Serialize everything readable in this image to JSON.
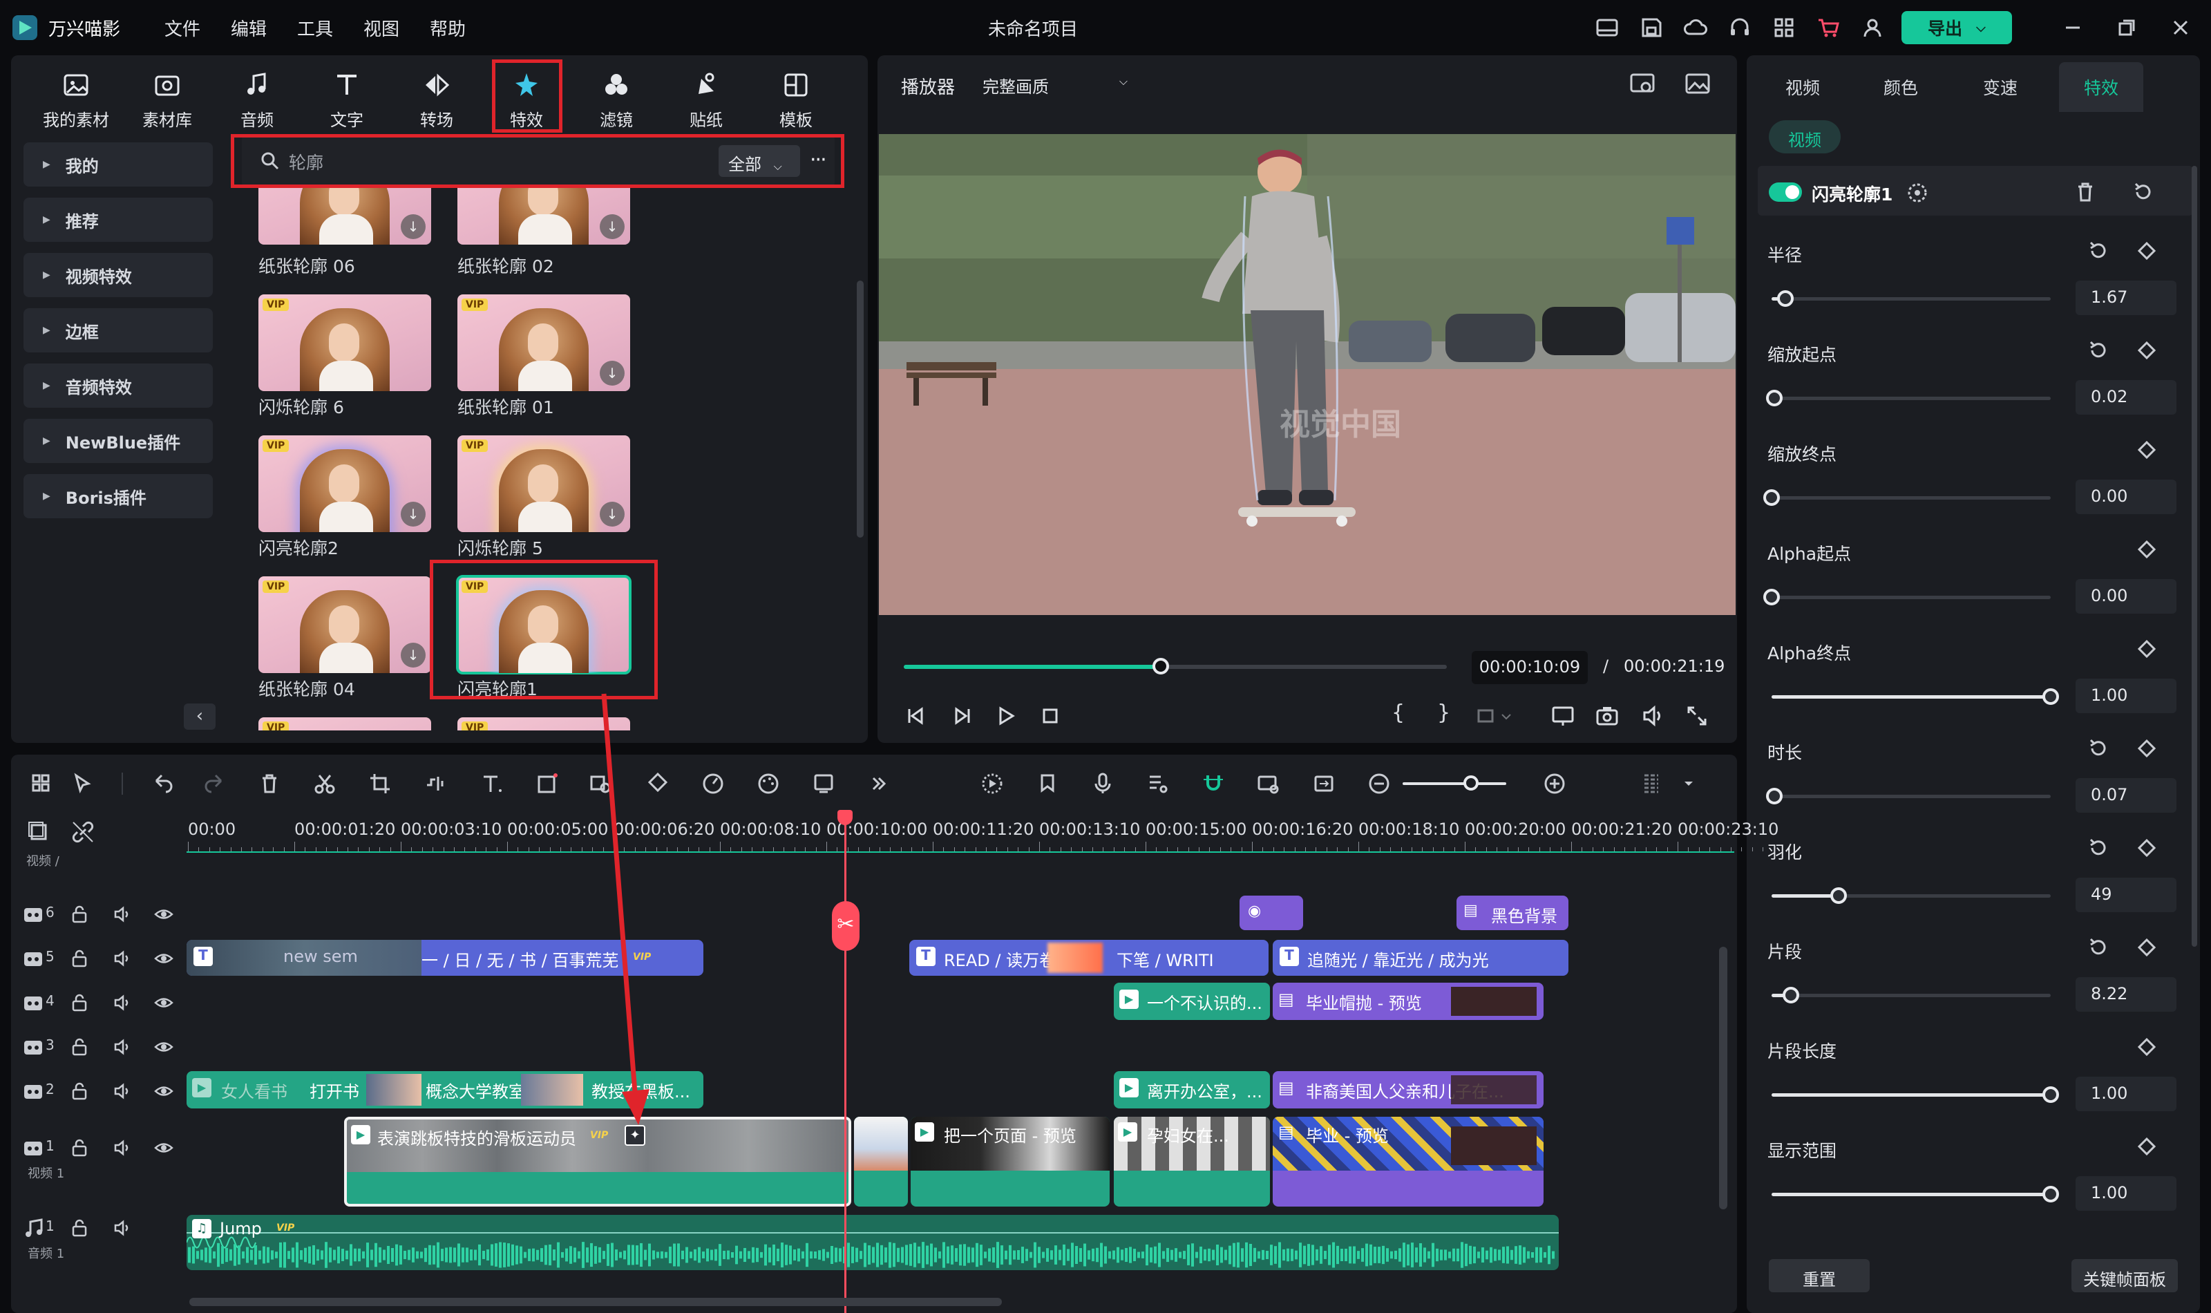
{
  "app": {
    "name": "万兴喵影",
    "menus": [
      "文件",
      "编辑",
      "工具",
      "视图",
      "帮助"
    ],
    "window_title": "未命名项目",
    "export_label": "导出",
    "accent": "#16c79a"
  },
  "library": {
    "tabs": [
      "我的素材",
      "素材库",
      "音频",
      "文字",
      "转场",
      "特效",
      "滤镜",
      "贴纸",
      "模板"
    ],
    "active_tab": "特效",
    "categories": [
      "我的",
      "推荐",
      "视频特效",
      "边框",
      "音频特效",
      "NewBlue插件",
      "Boris插件"
    ],
    "search": {
      "value": "轮廓",
      "filter": "全部"
    },
    "items": [
      {
        "label": "纸张轮廓 06",
        "vip": false
      },
      {
        "label": "纸张轮廓 02",
        "vip": false
      },
      {
        "label": "闪烁轮廓 6",
        "vip": true
      },
      {
        "label": "纸张轮廓 01",
        "vip": true
      },
      {
        "label": "闪亮轮廓2",
        "vip": true
      },
      {
        "label": "闪烁轮廓 5",
        "vip": true
      },
      {
        "label": "纸张轮廓 04",
        "vip": true
      },
      {
        "label": "闪亮轮廓1",
        "vip": true
      }
    ],
    "vip_badge": "VIP"
  },
  "player": {
    "label": "播放器",
    "quality": "完整画质",
    "watermark": "视觉中国",
    "current_time": "00:00:10:09",
    "separator": "/",
    "total_time": "00:00:21:19",
    "progress": 0.47
  },
  "properties": {
    "tabs": [
      "视频",
      "颜色",
      "变速",
      "特效"
    ],
    "active_tab": "特效",
    "sub_tab": "视频",
    "effect_name": "闪亮轮廓1",
    "params": [
      {
        "label": "半径",
        "value": "1.67",
        "fraction": 0.05
      },
      {
        "label": "缩放起点",
        "value": "0.02",
        "fraction": 0.01
      },
      {
        "label": "缩放终点",
        "value": "0.00",
        "fraction": 0.0
      },
      {
        "label": "Alpha起点",
        "value": "0.00",
        "fraction": 0.0
      },
      {
        "label": "Alpha终点",
        "value": "1.00",
        "fraction": 1.0
      },
      {
        "label": "时长",
        "value": "0.07",
        "fraction": 0.01
      },
      {
        "label": "羽化",
        "value": "49",
        "fraction": 0.24
      },
      {
        "label": "片段",
        "value": "8.22",
        "fraction": 0.07
      },
      {
        "label": "片段长度",
        "value": "1.00",
        "fraction": 1.0
      },
      {
        "label": "显示范围",
        "value": "1.00",
        "fraction": 1.0
      }
    ],
    "reset_label": "重置",
    "keyframe_label": "关键帧面板"
  },
  "timeline": {
    "ruler": [
      "00:00",
      "00:00:01:20",
      "00:00:03:10",
      "00:00:05:00",
      "00:00:06:20",
      "00:00:08:10",
      "00:00:10:00",
      "00:00:11:20",
      "00:00:13:10",
      "00:00:15:00",
      "00:00:16:20",
      "00:00:18:10",
      "00:00:20:00",
      "00:00:21:20",
      "00:00:23:10"
    ],
    "track_header_label": "视频 /",
    "tracks": [
      {
        "num": "6"
      },
      {
        "num": "5"
      },
      {
        "num": "4"
      },
      {
        "num": "3"
      },
      {
        "num": "2"
      },
      {
        "num": "1",
        "name": "视频 1"
      },
      {
        "num": "1",
        "name": "音频 1"
      }
    ],
    "clips": {
      "t6_bg": "黑色背景",
      "t5_a": "new sem",
      "t5_b": "一 / 日 / 无 / 书 / 百事荒芜",
      "t5_c": "READ / 读万卷",
      "t5_d": "下笔 / WRITI",
      "t5_e": "追随光 / 靠近光 / 成为光",
      "t4_a": "一个不认识的...",
      "t4_b": "毕业帽抛 - 预览",
      "t2_a": "女人看书",
      "t2_b": "打开书",
      "t2_c": "概念大学教室",
      "t2_d": "教授在黑板...",
      "t2_e": "离开办公室，...",
      "t2_f": "非裔美国人父亲和儿子在...",
      "t1_a": "表演跳板特技的滑板运动员",
      "t1_b": "把一个页面 - 预览",
      "t1_c": "孕妇女在...",
      "t1_d": "毕业 - 预览",
      "audio": "Jump"
    }
  }
}
